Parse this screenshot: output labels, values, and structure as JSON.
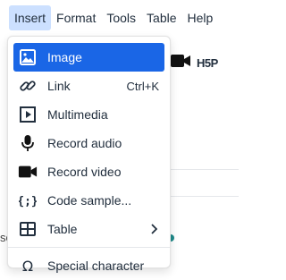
{
  "menubar": {
    "items": [
      {
        "label": "Insert"
      },
      {
        "label": "Format"
      },
      {
        "label": "Tools"
      },
      {
        "label": "Table"
      },
      {
        "label": "Help"
      }
    ]
  },
  "toolbar": {
    "video_icon": "video-camera-icon",
    "h5p_label": "H5P"
  },
  "background": {
    "partial_text": "sc"
  },
  "insert_menu": {
    "items": [
      {
        "label": "Image",
        "icon": "image-icon"
      },
      {
        "label": "Link",
        "icon": "link-icon",
        "shortcut": "Ctrl+K"
      },
      {
        "label": "Multimedia",
        "icon": "multimedia-icon"
      },
      {
        "label": "Record audio",
        "icon": "microphone-icon"
      },
      {
        "label": "Record video",
        "icon": "video-camera-icon"
      },
      {
        "label": "Code sample...",
        "icon": "code-braces-icon"
      },
      {
        "label": "Table",
        "icon": "table-icon",
        "submenu_icon": "chevron-right-icon"
      },
      {
        "label": "Special character",
        "icon": "omega-icon"
      }
    ]
  },
  "colors": {
    "active_menubar_bg": "#cce0ff",
    "selected_item_bg": "#1a66e6",
    "text": "#222f3e"
  }
}
